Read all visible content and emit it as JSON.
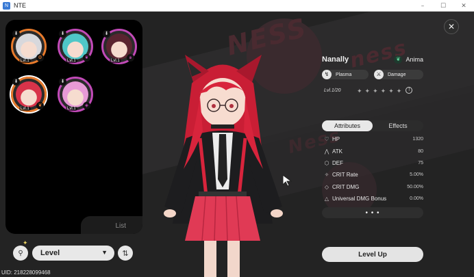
{
  "window": {
    "title": "NTE",
    "app_icon": "app-logo-icon",
    "controls": [
      "–",
      "☐",
      "✕"
    ]
  },
  "roster": {
    "list_label": "List",
    "characters": [
      {
        "level": "Lvl.1",
        "accent": "#e97b2c",
        "hair": "#d8d8dc",
        "element": "gear"
      },
      {
        "level": "Lvl.1",
        "accent": "#c24ab8",
        "hair": "#4fc7c7",
        "element": "leaf"
      },
      {
        "level": "Lvl.1",
        "accent": "#c24ab8",
        "hair": "#5a2430",
        "element": "spiral"
      },
      {
        "level": "Lvl.1",
        "accent": "#e97b2c",
        "hair": "#d8334a",
        "element": "leaf",
        "selected": true
      },
      {
        "level": "Lvl.1",
        "accent": "#c24ab8",
        "hair": "#e79ad6",
        "element": "drop"
      }
    ]
  },
  "controls": {
    "filter_icon": "filter-icon",
    "sort_label": "Level",
    "sort_order_icon": "sort-order-icon"
  },
  "uid": "UID: 218228099468",
  "character": {
    "name": "Nanally",
    "attribute": "Anima",
    "tags": [
      "Plasma",
      "Damage"
    ],
    "level_text": "Lvl.1/20",
    "stars_total": 6
  },
  "tabs": [
    "Attributes",
    "Effects"
  ],
  "stats": [
    {
      "icon": "heart-icon",
      "glyph": "♡",
      "name": "HP",
      "value": "1320"
    },
    {
      "icon": "atk-icon",
      "glyph": "⋀",
      "name": "ATK",
      "value": "80"
    },
    {
      "icon": "shield-icon",
      "glyph": "⬡",
      "name": "DEF",
      "value": "75"
    },
    {
      "icon": "crit-rate-icon",
      "glyph": "✧",
      "name": "CRIT Rate",
      "value": "5.00%"
    },
    {
      "icon": "crit-dmg-icon",
      "glyph": "◇",
      "name": "CRIT DMG",
      "value": "50.00%"
    },
    {
      "icon": "dmg-bonus-icon",
      "glyph": "△",
      "name": "Universal DMG Bonus",
      "value": "0.00%"
    }
  ],
  "more_label": "• • •",
  "level_up_label": "Level Up",
  "colors": {
    "accent_orange": "#e97b2c",
    "accent_magenta": "#c24ab8",
    "anima_green": "#5fd49a"
  }
}
